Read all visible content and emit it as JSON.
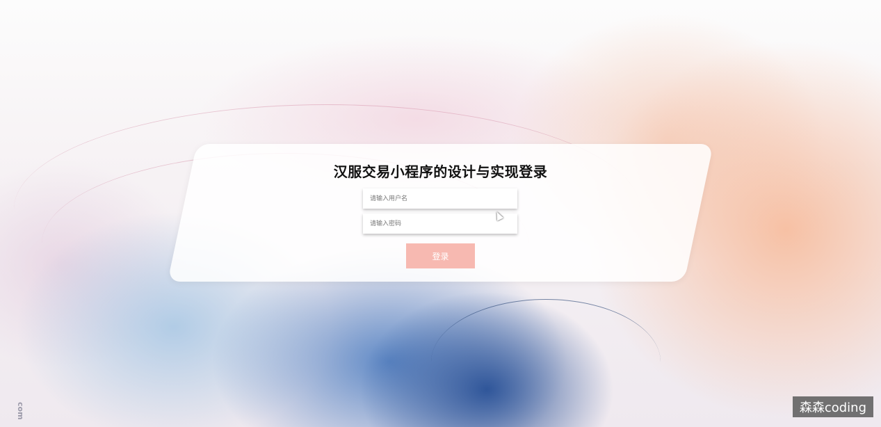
{
  "login": {
    "title": "汉服交易小程序的设计与实现登录",
    "username_placeholder": "请输入用户名",
    "password_placeholder": "请输入密码",
    "login_label": "登录"
  },
  "overlay": {
    "watermark": "森森coding",
    "side_text": "com"
  },
  "colors": {
    "button": "#f7b9b1",
    "card": "#ffffff"
  }
}
